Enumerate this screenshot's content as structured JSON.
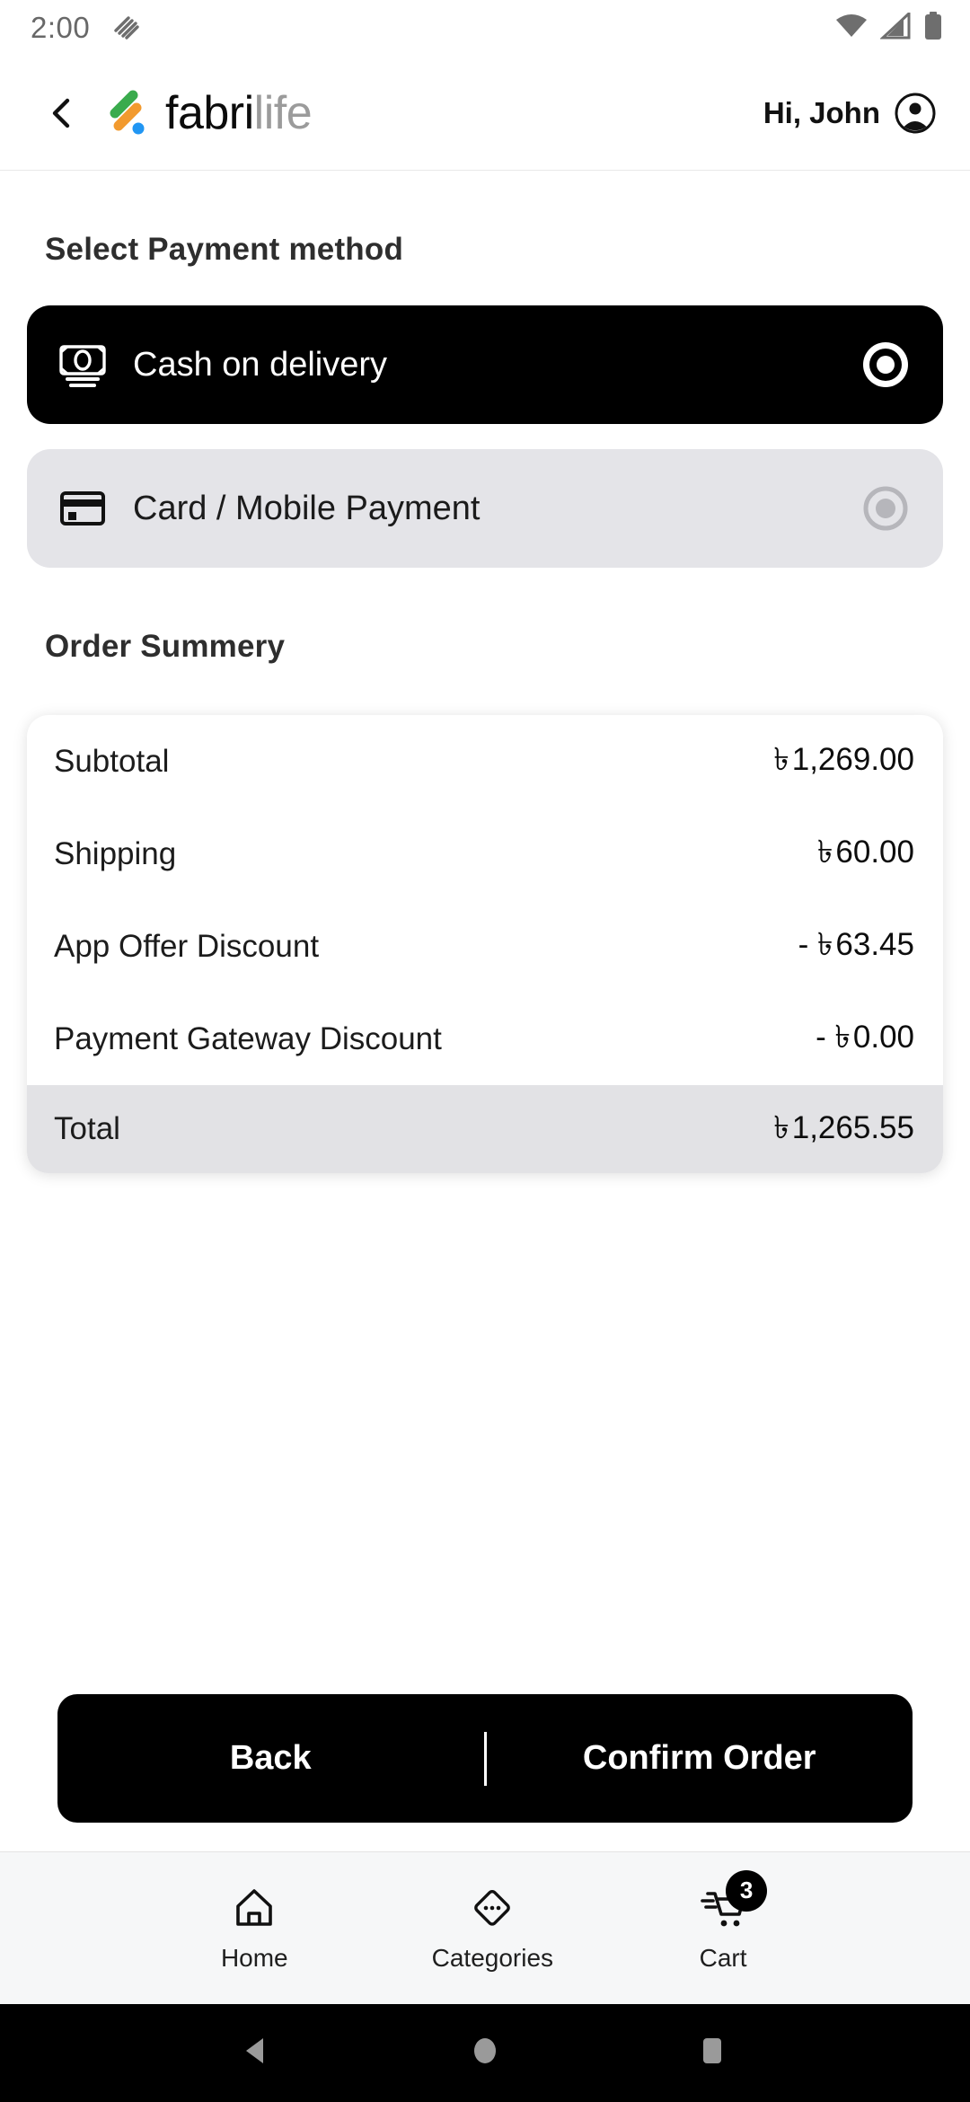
{
  "statusbar": {
    "time": "2:00",
    "icons": [
      "notification-stripes-icon",
      "wifi-icon",
      "cellular-signal-icon",
      "battery-icon"
    ]
  },
  "header": {
    "back_icon": "back-chevron-icon",
    "brand_primary": "fabri",
    "brand_secondary": "life",
    "greeting": "Hi, John",
    "avatar_icon": "account-circle-icon"
  },
  "payment": {
    "section_title": "Select Payment method",
    "options": [
      {
        "label": "Cash on delivery",
        "icon": "banknotes-icon",
        "selected": true
      },
      {
        "label": "Card / Mobile Payment",
        "icon": "credit-card-icon",
        "selected": false
      }
    ]
  },
  "summary": {
    "section_title": "Order Summery",
    "rows": [
      {
        "label": "Subtotal",
        "value": "৳ 1,269.00"
      },
      {
        "label": "Shipping",
        "value": "৳ 60.00"
      },
      {
        "label": "App Offer Discount",
        "value": "- ৳ 63.45"
      },
      {
        "label": "Payment Gateway Discount",
        "value": "- ৳ 0.00"
      }
    ],
    "total": {
      "label": "Total",
      "value": "৳ 1,265.55"
    }
  },
  "actions": {
    "back_label": "Back",
    "confirm_label": "Confirm Order"
  },
  "bottomnav": {
    "items": [
      {
        "label": "Home",
        "icon": "home-icon"
      },
      {
        "label": "Categories",
        "icon": "categories-diamond-icon"
      },
      {
        "label": "Cart",
        "icon": "shopping-cart-icon",
        "badge": "3"
      }
    ]
  },
  "androidnav": {
    "back": "android-back-icon",
    "home": "android-home-icon",
    "recents": "android-recents-icon"
  },
  "colors": {
    "accent_black": "#000000",
    "card_gray": "#e4e4e8",
    "total_gray": "#e2e2e5",
    "logo_green": "#3aab4d",
    "logo_orange": "#f29a2e",
    "logo_blue": "#2196f3"
  }
}
